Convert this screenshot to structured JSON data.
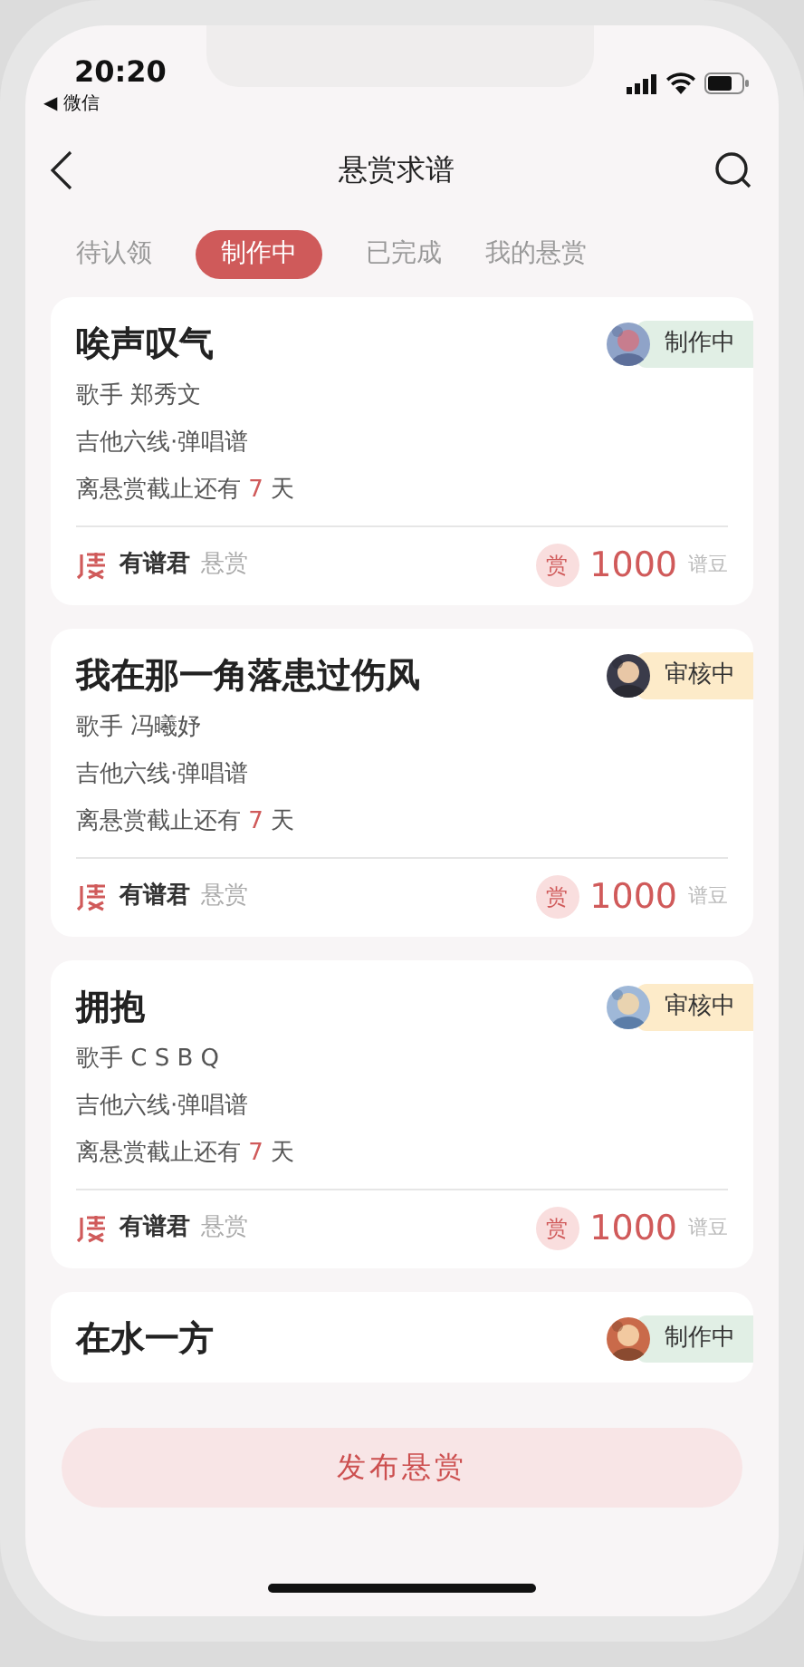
{
  "status_bar": {
    "time": "20:20",
    "back_app": "◀ 微信"
  },
  "nav": {
    "title": "悬赏求谱"
  },
  "tabs": [
    {
      "label": "待认领",
      "selected": false
    },
    {
      "label": "制作中",
      "selected": true
    },
    {
      "label": "已完成",
      "selected": false
    },
    {
      "label": "我的悬赏",
      "selected": false
    }
  ],
  "requests": [
    {
      "title": "唉声叹气",
      "status": {
        "kind": "making",
        "label": "制作中"
      },
      "singer": "歌手 郑秀文",
      "type": "吉他六线·弹唱谱",
      "deadline_prefix": "离悬赏截止还有",
      "days": "7",
      "deadline_suffix": "天",
      "sponsor": "有谱君",
      "sponsor_action": "悬赏",
      "reward_mark": "赏",
      "reward": "1000",
      "unit": "谱豆"
    },
    {
      "title": "我在那一角落患过伤风",
      "status": {
        "kind": "review",
        "label": "审核中"
      },
      "singer": "歌手 冯曦妤",
      "type": "吉他六线·弹唱谱",
      "deadline_prefix": "离悬赏截止还有",
      "days": "7",
      "deadline_suffix": "天",
      "sponsor": "有谱君",
      "sponsor_action": "悬赏",
      "reward_mark": "赏",
      "reward": "1000",
      "unit": "谱豆"
    },
    {
      "title": "拥抱",
      "status": {
        "kind": "review",
        "label": "审核中"
      },
      "singer": "歌手 C S B Q",
      "type": "吉他六线·弹唱谱",
      "deadline_prefix": "离悬赏截止还有",
      "days": "7",
      "deadline_suffix": "天",
      "sponsor": "有谱君",
      "sponsor_action": "悬赏",
      "reward_mark": "赏",
      "reward": "1000",
      "unit": "谱豆"
    },
    {
      "title": "在水一方",
      "status": {
        "kind": "making",
        "label": "制作中"
      }
    }
  ],
  "publish_button": "发布悬赏"
}
